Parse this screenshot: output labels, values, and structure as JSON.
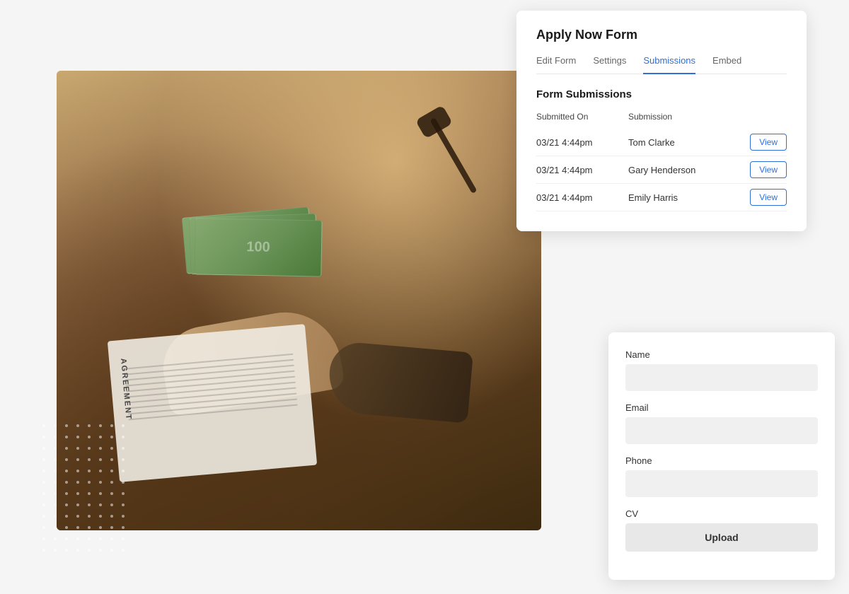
{
  "page": {
    "background": "#f0f0f0"
  },
  "submissions_panel": {
    "title": "Apply Now Form",
    "tabs": [
      {
        "id": "edit-form",
        "label": "Edit Form",
        "active": false
      },
      {
        "id": "settings",
        "label": "Settings",
        "active": false
      },
      {
        "id": "submissions",
        "label": "Submissions",
        "active": true
      },
      {
        "id": "embed",
        "label": "Embed",
        "active": false
      }
    ],
    "section_title": "Form Submissions",
    "table": {
      "headers": {
        "date": "Submitted On",
        "submission": "Submission"
      },
      "rows": [
        {
          "date": "03/21 4:44pm",
          "name": "Tom Clarke",
          "action": "View"
        },
        {
          "date": "03/21 4:44pm",
          "name": "Gary Henderson",
          "action": "View"
        },
        {
          "date": "03/21 4:44pm",
          "name": "Emily Harris",
          "action": "View"
        }
      ]
    }
  },
  "form_panel": {
    "fields": [
      {
        "id": "name",
        "label": "Name",
        "type": "text"
      },
      {
        "id": "email",
        "label": "Email",
        "type": "email"
      },
      {
        "id": "phone",
        "label": "Phone",
        "type": "tel"
      },
      {
        "id": "cv",
        "label": "CV",
        "type": "upload",
        "button_label": "Upload"
      }
    ]
  },
  "dots": {
    "count": 96
  }
}
